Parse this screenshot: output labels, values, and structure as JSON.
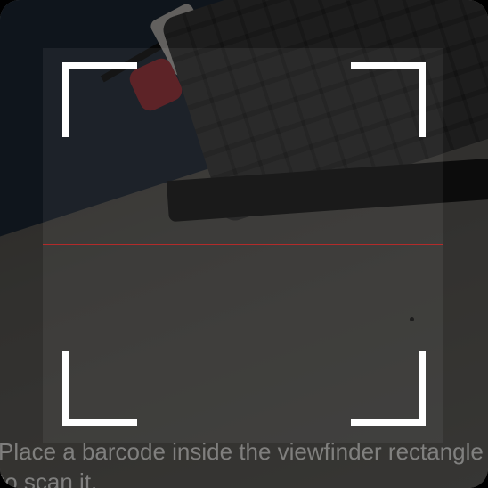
{
  "scanner": {
    "instruction_text": "Place a barcode inside the viewfinder rectangle to scan it.",
    "colors": {
      "corner": "#ffffff",
      "laser": "#c82828",
      "mask": "rgba(0,0,0,0.55)",
      "instruction": "#bebebe"
    }
  }
}
